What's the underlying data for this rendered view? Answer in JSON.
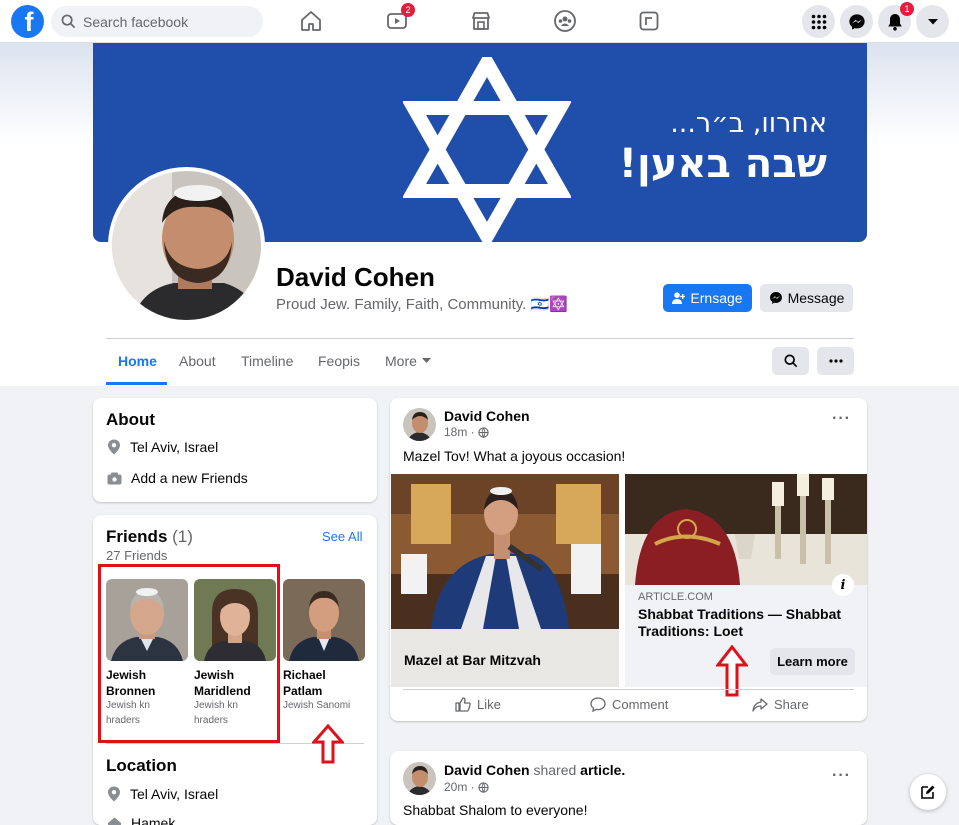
{
  "topbar": {
    "logo": "f",
    "search_placeholder": "Search facebook",
    "video_badge": "2",
    "notifications_badge": "1"
  },
  "cover": {
    "line1": "אחרוו, ב״ר...",
    "line2": "שבה באען!",
    "color": "#1f4fab"
  },
  "profile": {
    "name": "David Cohen",
    "bio": "Proud Jew. Family, Faith, Community. 🇮🇱🔯",
    "primary_button": "Ernsage",
    "secondary_button": "Message"
  },
  "tabs": {
    "home": "Home",
    "about": "About",
    "timeline": "Timeline",
    "feopis": "Feopis",
    "more": "More"
  },
  "about_card": {
    "title": "About",
    "location": "Tel Aviv, Israel",
    "add_friends": "Add a new Friends"
  },
  "friends_card": {
    "title": "Friends",
    "count": "(1)",
    "subtitle": "27 Friends",
    "see_all": "See All",
    "friends": [
      {
        "name_line1": "Jewish",
        "name_line2": "Bronnen",
        "sub_line1": "Jewish kn",
        "sub_line2": "hraders"
      },
      {
        "name_line1": "Jewish",
        "name_line2": "Maridlend",
        "sub_line1": "Jewish kn",
        "sub_line2": "hraders"
      },
      {
        "name_line1": "Richael",
        "name_line2": "Patlam",
        "sub_line1": "Jewish Sanomi",
        "sub_line2": ""
      }
    ]
  },
  "location_card": {
    "title": "Location",
    "location": "Tel Aviv, Israel",
    "partial": "Hamek"
  },
  "post1": {
    "author": "David Cohen",
    "time": "18m ·",
    "text": "Mazel Tov! What a joyous occasion!",
    "photo_caption": "Mazel at Bar Mitzvah",
    "link_domain": "ARTICLE.COM",
    "link_title": "Shabbat Traditions — Shabbat Traditions: Loet",
    "learn_more": "Learn more",
    "info": "i",
    "like": "Like",
    "comment": "Comment",
    "share": "Share"
  },
  "post2": {
    "author": "David Cohen",
    "shared": "shared",
    "article": "article.",
    "time": "20m ·",
    "text": "Shabbat Shalom to everyone!"
  },
  "colors": {
    "accent": "#1877f2",
    "annotation": "#e0101b",
    "badge": "#e41e3f"
  }
}
